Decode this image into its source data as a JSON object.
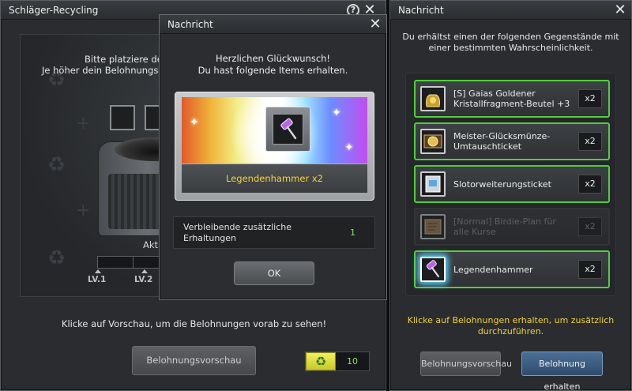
{
  "left_window": {
    "title": "Schläger-Recycling",
    "help_icon": "?",
    "close_icon": "✕",
    "intro_line1": "Bitte platziere den",
    "intro_line2": "Je höher dein Belohnungsle",
    "aktuell_label": "Aktu",
    "levels": [
      "LV.1",
      "LV.2"
    ],
    "hint": "Klicke auf Vorschau, um die Belohnungen vorab zu sehen!",
    "preview_button": "Belohnungsvorschau",
    "recycle_icon": "♻",
    "count": "10",
    "gauge_fill": 0
  },
  "dialog": {
    "title": "Nachricht",
    "close_icon": "✕",
    "line1": "Herzlichen Glückwunsch!",
    "line2": "Du hast folgende Items erhalten.",
    "item_icon": "hammer-icon",
    "item_name": "Legendenhammer x2",
    "remain_label": "Verbleibende zusätzliche Erhaltungen",
    "remain_value": "1",
    "ok_button": "OK"
  },
  "right_window": {
    "title": "Nachricht",
    "close_icon": "✕",
    "description": "Du erhältst einen der folgenden Gegenstände mit einer bestimmten Wahrscheinlichkeit.",
    "rewards": [
      {
        "name": "[S] Gaias Goldener Kristallfragment-Beutel +3",
        "qty": "x2",
        "icon": "bag-icon",
        "active": true
      },
      {
        "name": "Meister-Glücksmünze-Umtauschticket",
        "qty": "x2",
        "icon": "coin-icon",
        "active": true
      },
      {
        "name": "Slotorweiterungsticket",
        "qty": "x2",
        "icon": "ticket-icon",
        "active": true
      },
      {
        "name": "[Normal] Birdie-Plan für alle Kurse",
        "qty": "x2",
        "icon": "map-icon",
        "active": false
      },
      {
        "name": "Legendenhammer",
        "qty": "x2",
        "icon": "hammer-icon",
        "active": true
      }
    ],
    "hint": "Klicke auf Belohnungen erhalten, um zusätzlich durchzuführen.",
    "preview_button": "Belohnungsvorschau",
    "claim_button": "Belohnung erhalten"
  },
  "colors": {
    "accent_green": "#4fcf3a",
    "highlight_yellow": "#f2d43a",
    "value_green": "#8fe06a"
  }
}
